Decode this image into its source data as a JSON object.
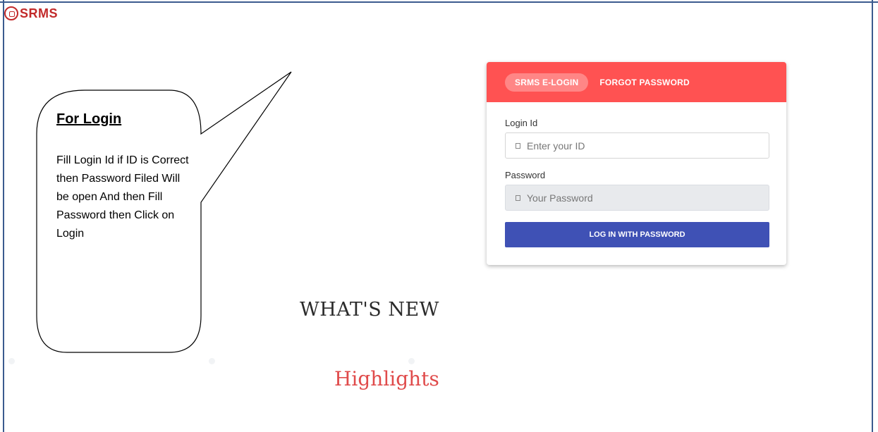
{
  "brand": {
    "logo_text": "SRMS",
    "color": "#c22a2a"
  },
  "callout": {
    "title": "For Login",
    "body": "Fill Login Id if ID is Correct then Password Filed Will be open And then Fill Password then Click on Login"
  },
  "login_card": {
    "header_color": "#ff5252",
    "tabs": [
      {
        "label": "SRMS E-LOGIN",
        "active": true
      },
      {
        "label": "FORGOT PASSWORD",
        "active": false
      }
    ],
    "login_id": {
      "label": "Login Id",
      "placeholder": "Enter your ID",
      "icon": "id-icon"
    },
    "password": {
      "label": "Password",
      "placeholder": "Your Password",
      "icon": "lock-icon",
      "disabled": true
    },
    "submit_label": "LOG IN WITH PASSWORD",
    "button_color": "#3f51b5"
  },
  "sections": {
    "whats_new": "WHAT'S NEW",
    "highlights": "Highlights"
  }
}
